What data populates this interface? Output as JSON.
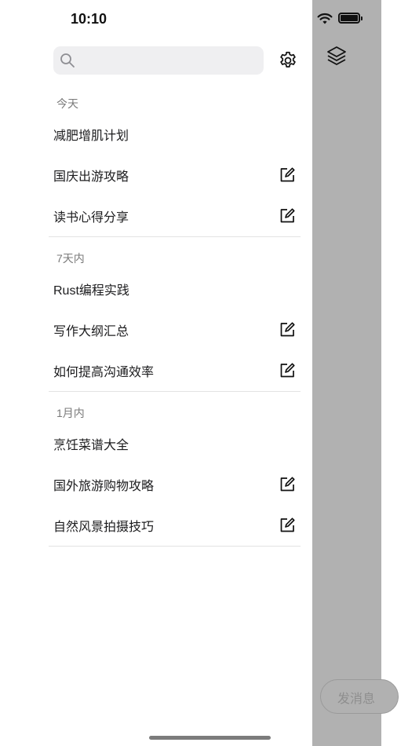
{
  "status_bar": {
    "time": "10:10"
  },
  "search": {
    "placeholder": ""
  },
  "sections": [
    {
      "title": "今天",
      "items": [
        {
          "label": "减肥增肌计划",
          "editable": false
        },
        {
          "label": "国庆出游攻略",
          "editable": true
        },
        {
          "label": "读书心得分享",
          "editable": true
        }
      ]
    },
    {
      "title": "7天内",
      "items": [
        {
          "label": "Rust编程实践",
          "editable": false
        },
        {
          "label": "写作大纲汇总",
          "editable": true
        },
        {
          "label": "如何提高沟通效率",
          "editable": true
        }
      ]
    },
    {
      "title": "1月内",
      "items": [
        {
          "label": "烹饪菜谱大全",
          "editable": false
        },
        {
          "label": "国外旅游购物攻略",
          "editable": true
        },
        {
          "label": "自然风景拍摄技巧",
          "editable": true
        }
      ]
    }
  ],
  "background_view": {
    "send_button_label": "发消息"
  },
  "icons": {
    "search": "search-icon",
    "settings": "gear-icon",
    "edit": "edit-icon",
    "layers": "layers-icon",
    "wifi": "wifi-icon",
    "battery": "battery-icon"
  },
  "colors": {
    "overlay": "#b1b1b1",
    "search_bg": "#efeff1",
    "divider": "#e3e3e3",
    "section_title": "#7a7a7a"
  }
}
